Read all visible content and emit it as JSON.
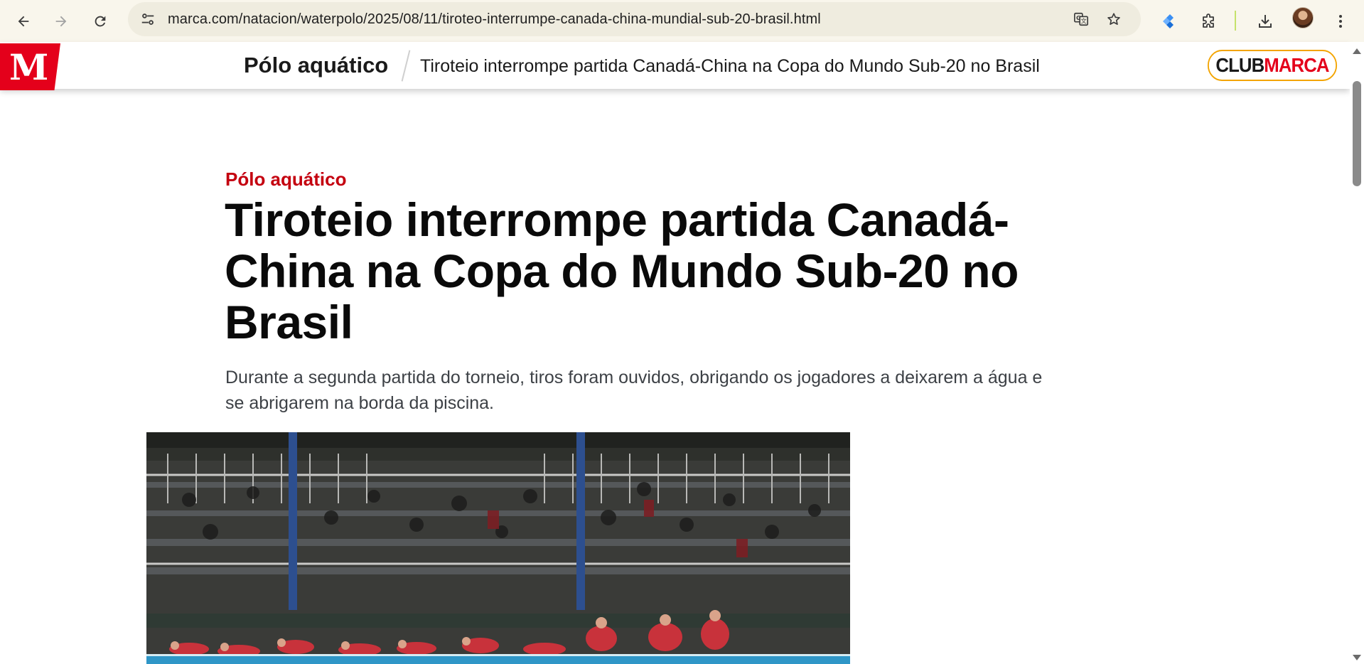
{
  "browser": {
    "url": "marca.com/natacion/waterpolo/2025/08/11/tiroteo-interrumpe-canada-china-mundial-sub-20-brasil.html",
    "icons": [
      "back-icon",
      "forward-icon",
      "reload-icon",
      "site-info-icon",
      "translate-icon",
      "bookmark-star-icon",
      "extension-diamond-icon",
      "extensions-puzzle-icon",
      "download-icon",
      "profile-avatar",
      "more-menu-icon"
    ]
  },
  "header": {
    "logo": "M",
    "section": "Pólo aquático",
    "headline": "Tiroteio interrompe partida Canadá-China na Copa do Mundo Sub-20 no Brasil",
    "club_part1": "CLUB",
    "club_part2": "MARCA"
  },
  "article": {
    "kicker": "Pólo aquático",
    "headline": "Tiroteio interrompe partida Canadá-China na Copa do Mundo Sub-20 no Brasil",
    "subtitle": "Durante a segunda partida do torneio, tiros foram ouvidos, obrigando os jogadores a deixarem a água e se abrigarem na borda da piscina."
  },
  "colors": {
    "brand_red": "#e4001b",
    "kicker_red": "#c4000f",
    "club_border": "#f3a400",
    "chrome_bg": "#f9f6ec"
  }
}
